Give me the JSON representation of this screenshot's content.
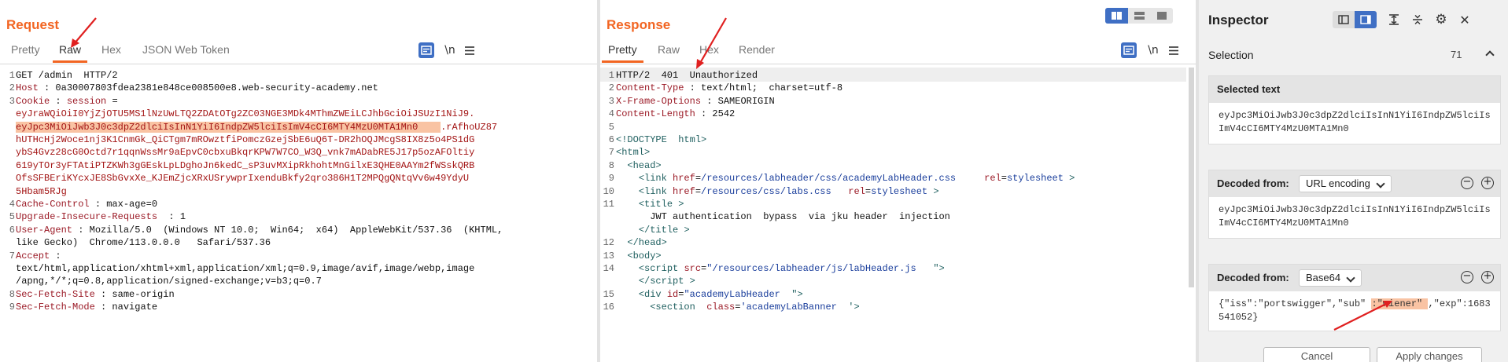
{
  "request": {
    "title": "Request",
    "tabs": [
      "Pretty",
      "Raw",
      "Hex",
      "JSON Web Token"
    ],
    "lines": [
      {
        "n": "1",
        "html": "GET /admin  HTTP/2"
      },
      {
        "n": "2",
        "html": "<span class='k'>Host</span> : 0a30007803fdea2381e848ce008500e8.web-security-academy.net"
      },
      {
        "n": "3",
        "html": "<span class='k'>Cookie</span> : <span class='k'>session</span> ="
      },
      {
        "n": "",
        "html": "<span class='ck'>eyJraWQiOiI0YjZjOTU5MS1lNzUwLTQ2ZDAtOTg2ZC03NGE3MDk4MThmZWEiLCJhbGciOiJSUzI1NiJ9.</span>"
      },
      {
        "n": "",
        "html": "<span class='ck hl'>eyJpc3MiOiJwb3J0c3dpZ2dlciIsInN1YiI6IndpZW5lciIsImV4cCI6MTY4MzU0MTA1Mn0    </span><span class='ck'>.rAfhoUZ87</span>"
      },
      {
        "n": "",
        "html": "<span class='ck'>hUTHcHj2Woce1nj3K1CnmGk_QiCTgm7mROwztfiPomczGzejSbE6uQ6T-DR2hOQJMcgS8IX8z5o4PS1dG</span>"
      },
      {
        "n": "",
        "html": "<span class='ck'>ybS4Gvz28cG0Octd7r1qqnWssMr9aEpvC0cbxuBkqrKPW7W7CO_W3Q_vnk7mADabRE5J17p5ozAFOltiy</span>"
      },
      {
        "n": "",
        "html": "<span class='ck'>619yTOr3yFTAtiPTZKWh3gGEskLpLDghoJn6kedC_sP3uvMXipRkhohtMnGilxE3QHE0AAYm2fWSskQRB</span>"
      },
      {
        "n": "",
        "html": "<span class='ck'>OfsSFBEriKYcxJE8SbGvxXe_KJEmZjcXRxUSrywprIxenduBkfy2qro386H1T2MPQgQNtqVv6w49YdyU</span>"
      },
      {
        "n": "",
        "html": "<span class='ck'>5Hbam5RJg</span>"
      },
      {
        "n": "4",
        "html": "<span class='k'>Cache-Control</span> : max-age=0"
      },
      {
        "n": "5",
        "html": "<span class='k'>Upgrade-Insecure-Requests</span>  : 1"
      },
      {
        "n": "6",
        "html": "<span class='k'>User-Agent</span> : Mozilla/5.0  (Windows NT 10.0;  Win64;  x64)  AppleWebKit/537.36  (KHTML,"
      },
      {
        "n": "",
        "html": "like Gecko)  Chrome/113.0.0.0   Safari/537.36"
      },
      {
        "n": "7",
        "html": "<span class='k'>Accept</span> :"
      },
      {
        "n": "",
        "html": "text/html,application/xhtml+xml,application/xml;q=0.9,image/avif,image/webp,image"
      },
      {
        "n": "",
        "html": "/apng,*/*;q=0.8,application/signed-exchange;v=b3;q=0.7"
      },
      {
        "n": "8",
        "html": "<span class='k'>Sec-Fetch-Site</span> : same-origin"
      },
      {
        "n": "9",
        "html": "<span class='k'>Sec-Fetch-Mode</span> : navigate"
      }
    ]
  },
  "response": {
    "title": "Response",
    "tabs": [
      "Pretty",
      "Raw",
      "Hex",
      "Render"
    ],
    "lines": [
      {
        "n": "1",
        "html": "HTTP/2  401  Unauthorized"
      },
      {
        "n": "2",
        "html": "<span class='k'>Content-Type</span> : text/html;  charset=utf-8"
      },
      {
        "n": "3",
        "html": "<span class='k'>X-Frame-Options</span> : SAMEORIGIN"
      },
      {
        "n": "4",
        "html": "<span class='k'>Content-Length</span> : 2542"
      },
      {
        "n": "5",
        "html": ""
      },
      {
        "n": "6",
        "html": "<span class='tag'>&lt;!DOCTYPE  html&gt;</span>"
      },
      {
        "n": "7",
        "html": "<span class='tag'>&lt;html&gt;</span>"
      },
      {
        "n": "8",
        "html": "  <span class='tag'>&lt;head&gt;</span>"
      },
      {
        "n": "9",
        "html": "    <span class='tag'>&lt;link</span> <span class='attr'>href</span>=<span class='av'>/resources/labheader/css/academyLabHeader.css</span>     <span class='attr'>rel</span>=<span class='av'>stylesheet</span> <span class='tag'>&gt;</span>"
      },
      {
        "n": "10",
        "html": "    <span class='tag'>&lt;link</span> <span class='attr'>href</span>=<span class='av'>/resources/css/labs.css</span>   <span class='attr'>rel</span>=<span class='av'>stylesheet</span> <span class='tag'>&gt;</span>"
      },
      {
        "n": "11",
        "html": "    <span class='tag'>&lt;title</span> <span class='tag'>&gt;</span>"
      },
      {
        "n": "",
        "html": "      JWT authentication  bypass  via jku header  injection"
      },
      {
        "n": "",
        "html": "    <span class='tag'>&lt;/title</span> <span class='tag'>&gt;</span>"
      },
      {
        "n": "12",
        "html": "  <span class='tag'>&lt;/head&gt;</span>"
      },
      {
        "n": "13",
        "html": "  <span class='tag'>&lt;body&gt;</span>"
      },
      {
        "n": "14",
        "html": "    <span class='tag'>&lt;script</span> <span class='attr'>src</span>=<span class='av'>\"/resources/labheader/js/labHeader.js</span>   <span class='tag'>\"&gt;</span>"
      },
      {
        "n": "",
        "html": "    <span class='tag'>&lt;/script</span> <span class='tag'>&gt;</span>"
      },
      {
        "n": "15",
        "html": "    <span class='tag'>&lt;div</span> <span class='attr'>id</span>=<span class='av'>\"academyLabHeader</span>  <span class='tag'>\"&gt;</span>"
      },
      {
        "n": "16",
        "html": "      <span class='tag'>&lt;section</span>  <span class='attr'>class</span>=<span class='av'>'academyLabBanner</span>  <span class='tag'>'&gt;</span>"
      }
    ]
  },
  "inspector": {
    "title": "Inspector",
    "selection_label": "Selection",
    "selection_count": "71",
    "selected_text_label": "Selected text",
    "selected_text": "eyJpc3MiOiJwb3J0c3dpZ2dlciIsInN1YiI6IndpZW5lciIsImV4cCI6MTY4MzU0MTA1Mn0",
    "decoded1_label": "Decoded from:",
    "decoded1_encoding": "URL encoding",
    "decoded1_value": "eyJpc3MiOiJwb3J0c3dpZ2dlciIsInN1YiI6IndpZW5lciIsImV4cCI6MTY4MzU0MTA1Mn0",
    "decoded2_label": "Decoded from:",
    "decoded2_encoding": "Base64",
    "decoded2_html": "{\"iss\":\"portswigger\",\"sub\" <span class='hl'> :\"wiener\" </span>,\"exp\":1683541052}",
    "cancel_label": "Cancel",
    "apply_label": "Apply changes"
  },
  "icons": {
    "pretty_toggle": "wrap-icon",
    "newline": "\\n",
    "menu": "menu-icon"
  },
  "colors": {
    "accent": "#f26522",
    "highlight": "#f9c3a3",
    "layout_active": "#3f6fc4"
  }
}
